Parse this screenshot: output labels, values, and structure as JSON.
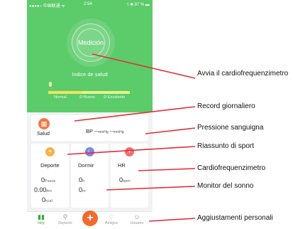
{
  "status_bar": {
    "carrier": "●●●●○ 中国联通 ᯤ",
    "time": "2:54",
    "battery": "⁊ ✱ 87 % ▬"
  },
  "hero": {
    "measure_label": "Medición",
    "index_label": "índice de salud"
  },
  "gauge": {
    "labels": [
      "Normal",
      "Bueno",
      "Excelente"
    ],
    "colors": {
      "low": "#f3e35c",
      "high": "#e8f08a"
    }
  },
  "record": {
    "title": "Salud",
    "bp_label": "BP",
    "bp_sys": "--",
    "bp_sys_unit": "mmHg",
    "bp_dia": "--",
    "bp_dia_unit": "mmHg"
  },
  "cards": {
    "deporte": {
      "title": "Deporte",
      "steps": "0",
      "steps_unit": "Pasos",
      "distance": "0.00",
      "distance_unit": "km",
      "kcal": "0",
      "kcal_unit": "kcal"
    },
    "dormir": {
      "title": "Dormir",
      "hours": "0",
      "hours_unit": "h",
      "minutes": "0",
      "minutes_unit": "m"
    },
    "hr": {
      "title": "HR",
      "bpm": "0",
      "bpm_unit": "bpm"
    }
  },
  "tabbar": {
    "hoy": "Hoy",
    "deporte": "Deporte",
    "add": "+",
    "amigos": "Amigos",
    "usuario": "Usuario"
  },
  "callouts": {
    "start": "Avvia il cardiofrequenzimetro",
    "record": "Record giornaliero",
    "pressure": "Pressione sanguigna",
    "sport": "Riassunto di sport",
    "hr": "Cardiofrequenzimetro",
    "sleep": "Monitor del sonno",
    "settings": "Aggiustamenti personali"
  },
  "colors": {
    "green": "#5ccb6a",
    "accent": "#f26a2d",
    "callout_line": "#e0303a"
  }
}
